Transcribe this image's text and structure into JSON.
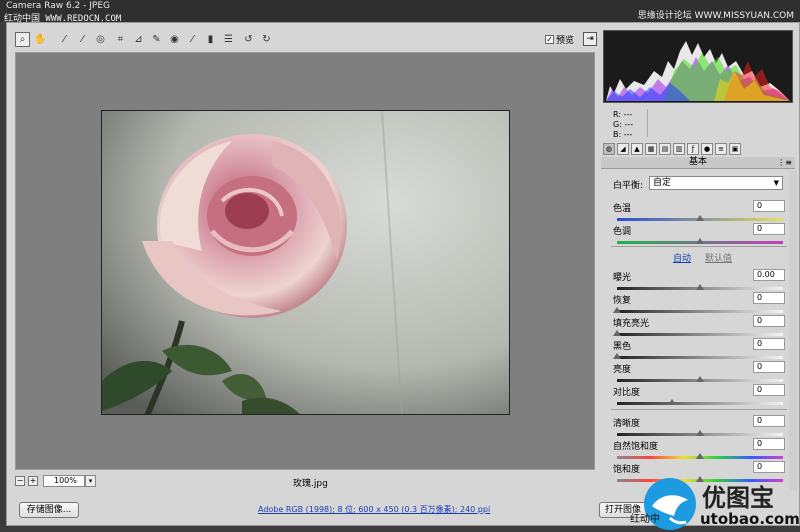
{
  "titlebar": {
    "title": "Camera Raw 6.2 - JPEG",
    "watermark_left": "红动中国 WWW.REDOCN.COM",
    "watermark_right": "思缘设计论坛 WWW.MISSYUAN.COM"
  },
  "toolbar": {
    "tools": [
      "zoom-icon",
      "hand-icon",
      "white-balance-icon",
      "color-sampler-icon",
      "target-adjust-icon",
      "crop-icon",
      "straighten-icon",
      "spot-removal-icon",
      "red-eye-icon",
      "adjustment-brush-icon",
      "graduated-filter-icon",
      "preferences-icon",
      "rotate-ccw-icon",
      "rotate-cw-icon"
    ],
    "preview_label": "预览",
    "preview_checked": "✓"
  },
  "status": {
    "zoom": "100%",
    "filename": "玫瑰.jpg"
  },
  "bottom": {
    "save_label": "存储图像...",
    "workflow": "Adobe RGB (1998); 8 位; 600 x 450 (0.3 百万像素); 240 ppi",
    "open_label": "打开图像"
  },
  "readout": {
    "r": "R:  ---",
    "g": "G:  ---",
    "b": "B:  ---"
  },
  "panel": {
    "header": "基本",
    "wb_label": "白平衡:",
    "wb_value": "自定",
    "auto": "自动",
    "default": "默认值",
    "sliders": [
      {
        "label": "色温",
        "value": "0",
        "pos": 0.5,
        "track": "temp"
      },
      {
        "label": "色调",
        "value": "0",
        "pos": 0.5,
        "track": "tint"
      },
      {
        "label": "曝光",
        "value": "0.00",
        "pos": 0.5,
        "track": "gray"
      },
      {
        "label": "恢复",
        "value": "0",
        "pos": 0.0,
        "track": "gray"
      },
      {
        "label": "填充亮光",
        "value": "0",
        "pos": 0.0,
        "track": "gray"
      },
      {
        "label": "黑色",
        "value": "0",
        "pos": 0.0,
        "track": "gray"
      },
      {
        "label": "亮度",
        "value": "0",
        "pos": 0.5,
        "track": "gray"
      },
      {
        "label": "对比度",
        "value": "0",
        "pos": 0.33,
        "track": "gray"
      },
      {
        "label": "清晰度",
        "value": "0",
        "pos": 0.5,
        "track": "gray"
      },
      {
        "label": "自然饱和度",
        "value": "0",
        "pos": 0.5,
        "track": "sat"
      },
      {
        "label": "饱和度",
        "value": "0",
        "pos": 0.5,
        "track": "sat"
      }
    ]
  },
  "brand": {
    "name": "优图宝",
    "url": "utobao.com",
    "overlay": "红动中"
  },
  "colors": {
    "accent": "#1a3db5",
    "panel": "#d6d6d6",
    "preview_bg": "#7f7f7f"
  }
}
